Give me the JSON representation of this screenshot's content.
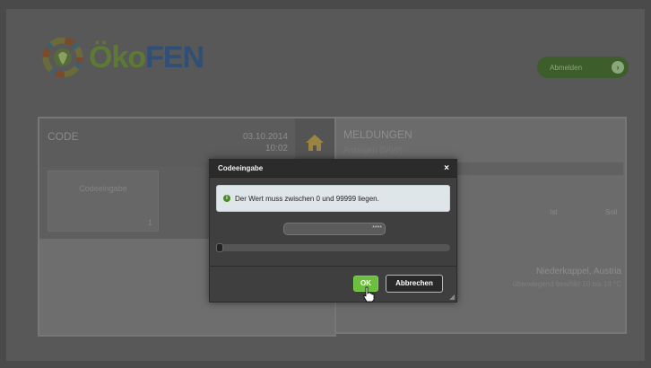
{
  "header": {
    "logo": {
      "text_a": "Öko",
      "text_b": "FEN"
    },
    "logout_label": "Abmelden",
    "logout_icon": "arrow-right-icon"
  },
  "left_panel": {
    "title": "CODE",
    "date": "03.10.2014",
    "time": "10:02",
    "home_icon": "home-icon",
    "tile_label": "Codeeingabe",
    "tile_value": "1"
  },
  "right_panel": {
    "title": "MELDUNGEN",
    "subtitle": "Anzeigen (0/0/0)",
    "col_ist": "Ist",
    "col_soll": "Soll",
    "location": "Niederkappel, Austria",
    "weather": "überwiegend bewölkt 10 bis 14 °C"
  },
  "dialog": {
    "title": "Codeeingabe",
    "close": "×",
    "message": "Der Wert muss zwischen 0 und 99999 liegen.",
    "password_value": "****",
    "ok_label": "OK",
    "cancel_label": "Abbrechen"
  },
  "colors": {
    "accent_green": "#6bbf3c",
    "logo_green": "#5c7a33",
    "logo_blue": "#2f4f77"
  }
}
